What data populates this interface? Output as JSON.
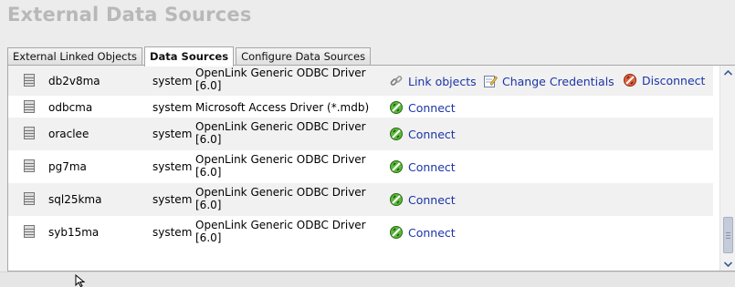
{
  "header": {
    "title": "External Data Sources"
  },
  "tabs": [
    {
      "label": "External Linked Objects",
      "active": false
    },
    {
      "label": "Data Sources",
      "active": true
    },
    {
      "label": "Configure Data Sources",
      "active": false
    }
  ],
  "datasources": [
    {
      "name": "db2v8ma",
      "owner": "system",
      "driver": "OpenLink Generic ODBC Driver [6.0]",
      "connected": true
    },
    {
      "name": "odbcma",
      "owner": "system",
      "driver": "Microsoft Access Driver (*.mdb)",
      "connected": false
    },
    {
      "name": "oraclee",
      "owner": "system",
      "driver": "OpenLink Generic ODBC Driver [6.0]",
      "connected": false
    },
    {
      "name": "pg7ma",
      "owner": "system",
      "driver": "OpenLink Generic ODBC Driver [6.0]",
      "connected": false
    },
    {
      "name": "sql25kma",
      "owner": "system",
      "driver": "OpenLink Generic ODBC Driver [6.0]",
      "connected": false
    },
    {
      "name": "syb15ma",
      "owner": "system",
      "driver": "OpenLink Generic ODBC Driver [6.0]",
      "connected": false
    }
  ],
  "actions": {
    "link_objects": "Link objects",
    "change_credentials": "Change Credentials",
    "disconnect": "Disconnect",
    "connect": "Connect"
  },
  "colors": {
    "link": "#1a35a8",
    "title": "#b8b8b8",
    "stripe": "#f1f1f1",
    "connect_icon": "#3e9a2a",
    "disconnect_icon": "#d8482a"
  },
  "icons": {
    "datasource": "database-icon",
    "link_objects": "chain-link-icon",
    "change_credentials": "edit-note-icon",
    "disconnect": "plug-disconnect-icon",
    "connect": "plug-connect-icon"
  }
}
